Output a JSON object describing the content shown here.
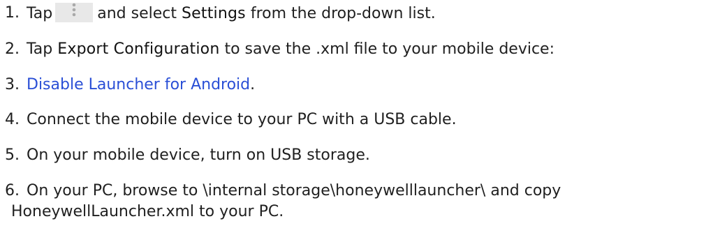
{
  "steps": [
    {
      "number": "1.",
      "pre": "Tap",
      "icon": "overflow-menu-icon",
      "mid": "and select",
      "bold": "Settings",
      "post": "from the drop-down list."
    },
    {
      "number": "2.",
      "pre": "Tap",
      "bold": "Export Configuration",
      "post": "to save the .xml file to your mobile device:"
    },
    {
      "number": "3.",
      "link": "Disable Launcher for Android",
      "post": "."
    },
    {
      "number": "4.",
      "text": "Connect the mobile device to your PC with a USB cable."
    },
    {
      "number": "5.",
      "text": "On your mobile device, turn on USB storage."
    },
    {
      "number": "6.",
      "line1": "On your PC, browse to \\internal storage\\honeywelllauncher\\ and copy",
      "line2": "HoneywellLauncher.xml to your PC."
    }
  ],
  "colors": {
    "text": "#1f1f1f",
    "link": "#2a4fd6",
    "icon_bg": "#e8e8e8",
    "icon_dots": "#a9a9a9"
  }
}
